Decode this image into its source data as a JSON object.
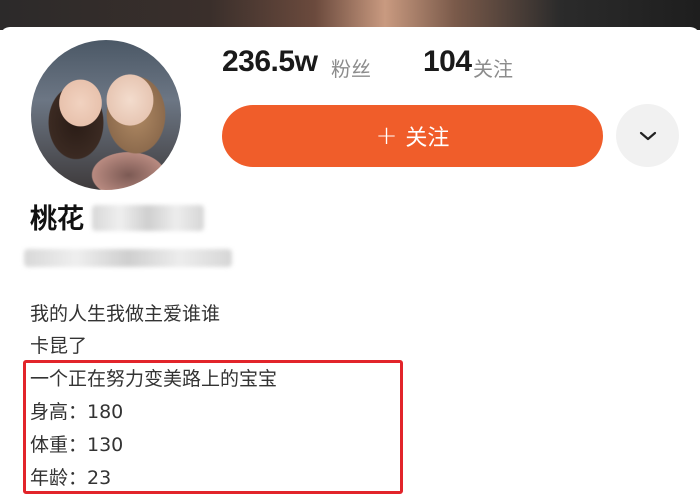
{
  "profile": {
    "followers_count": "236.5w",
    "followers_label": "粉丝",
    "following_count": "104",
    "following_label": "关注",
    "follow_button_plus": "+",
    "follow_button_label": "关注",
    "name_visible": "桃花"
  },
  "bio": [
    "我的人生我做主爱谁谁",
    "卡昆了",
    "一个正在努力变美路上的宝宝",
    "身高：180",
    "体重：130",
    "年龄：23"
  ],
  "colors": {
    "accent": "#f05d2a",
    "highlight_border": "#e2242a"
  },
  "icons": {
    "more": "chevron-down-icon"
  }
}
